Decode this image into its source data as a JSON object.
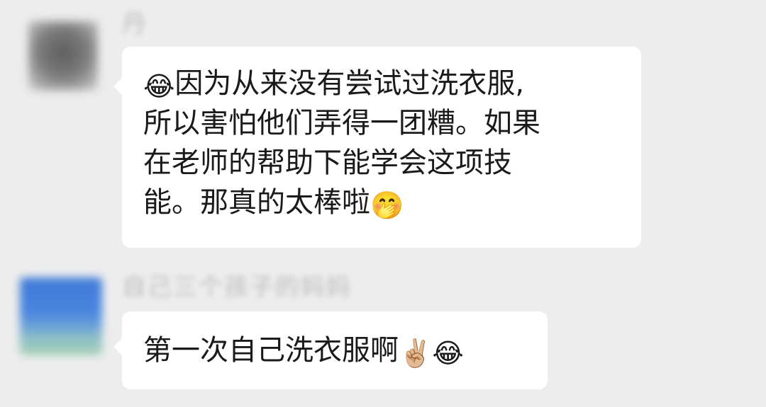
{
  "messages": [
    {
      "sender": "丹",
      "lines": [
        {
          "lead_emoji": "😂",
          "text": "因为从来没有尝试过洗衣服,"
        },
        {
          "text": "所以害怕他们弄得一团糟。如果"
        },
        {
          "text": "在老师的帮助下能学会这项技"
        },
        {
          "text": "能。那真的太棒啦",
          "trail_emoji": "🤭"
        }
      ]
    },
    {
      "sender": "自己三个孩子的妈妈",
      "text": "第一次自己洗衣服啊",
      "trail_emoji_1": "✌🏼",
      "trail_emoji_2": "😂"
    }
  ]
}
